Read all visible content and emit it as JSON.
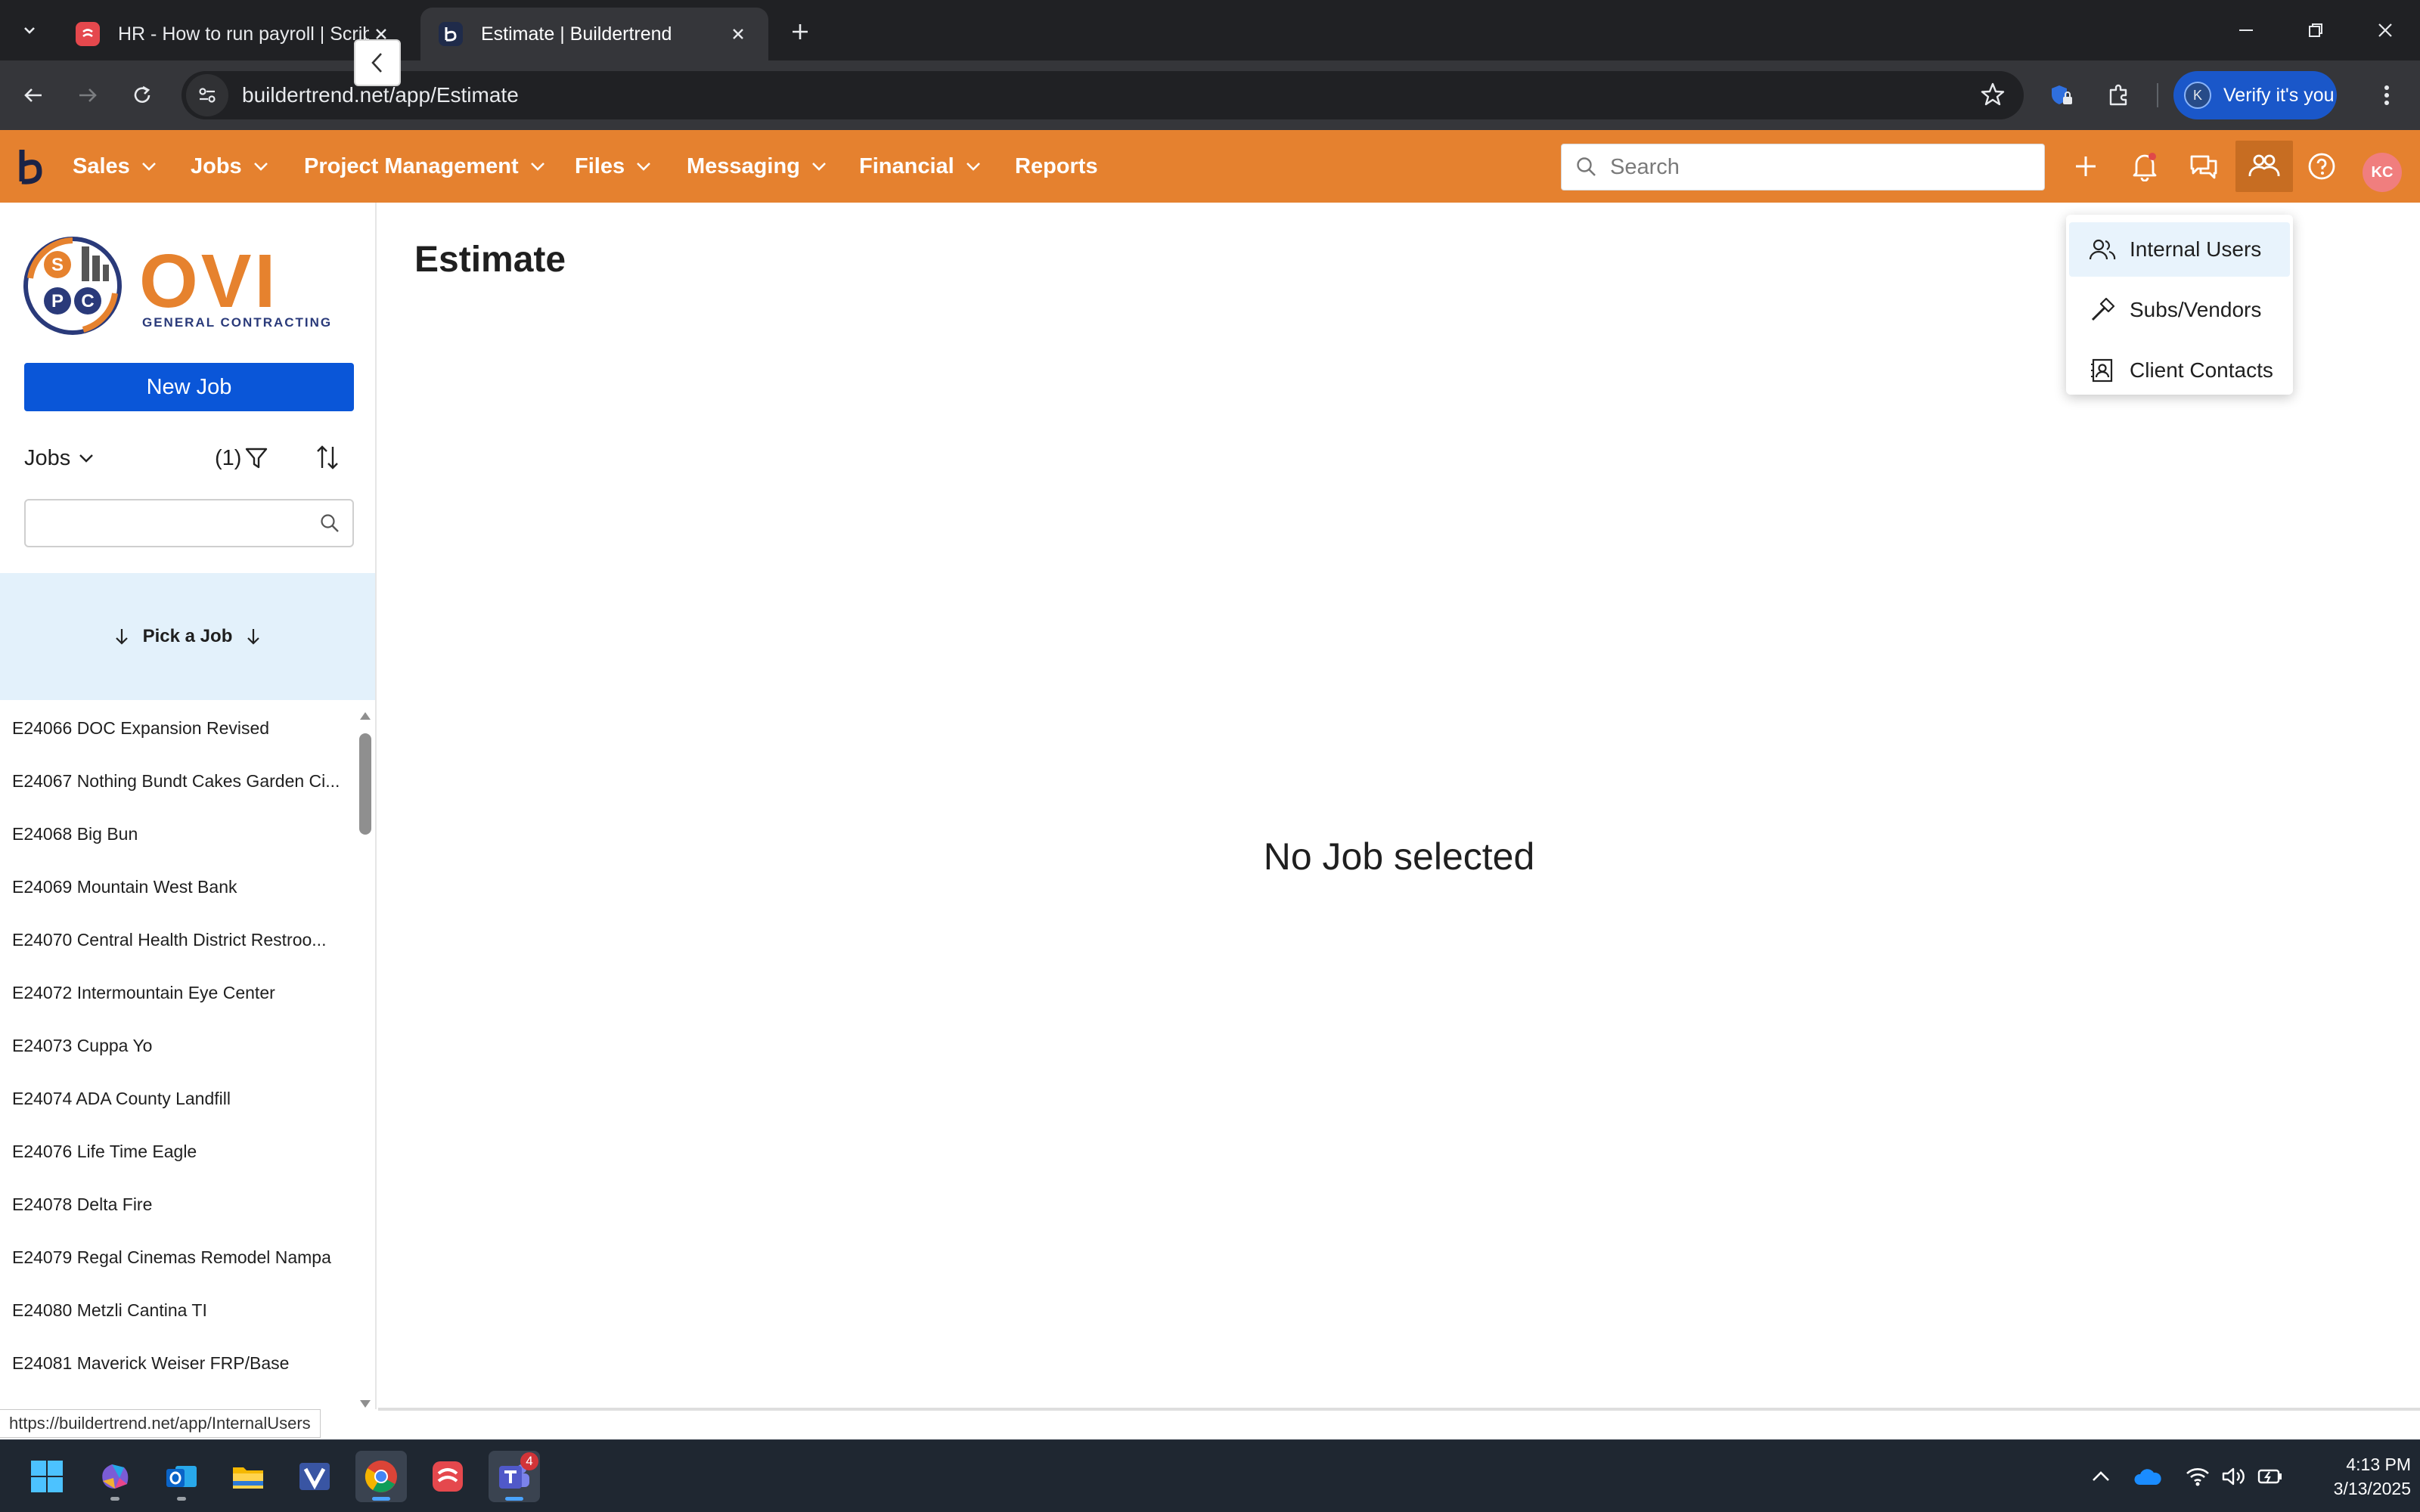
{
  "browser": {
    "tabs": [
      {
        "title": "HR - How to run payroll | Scribe",
        "active": false,
        "favicon": "scribe-icon"
      },
      {
        "title": "Estimate | Buildertrend",
        "active": true,
        "favicon": "buildertrend-icon"
      }
    ],
    "url": "buildertrend.net/app/Estimate",
    "profile_initial": "K",
    "verify_label": "Verify it's you"
  },
  "appnav": {
    "items": [
      {
        "label": "Sales",
        "has_menu": true
      },
      {
        "label": "Jobs",
        "has_menu": true
      },
      {
        "label": "Project Management",
        "has_menu": true
      },
      {
        "label": "Files",
        "has_menu": true
      },
      {
        "label": "Messaging",
        "has_menu": true
      },
      {
        "label": "Financial",
        "has_menu": true
      },
      {
        "label": "Reports",
        "has_menu": false
      }
    ],
    "search_placeholder": "Search",
    "avatar_initials": "KC",
    "accent_color": "#e5812f"
  },
  "contacts_menu": {
    "items": [
      {
        "label": "Internal Users",
        "icon": "users-icon"
      },
      {
        "label": "Subs/Vendors",
        "icon": "hammer-icon"
      },
      {
        "label": "Client Contacts",
        "icon": "contact-card-icon"
      }
    ]
  },
  "sidebar": {
    "logo": {
      "initials": [
        "S",
        "P",
        "C"
      ],
      "wordmark": "OVI",
      "tagline": "GENERAL CONTRACTING"
    },
    "new_job_label": "New Job",
    "jobs_dropdown_label": "Jobs",
    "filter_count": "(1)",
    "search_value": "",
    "pick_job_label": "Pick a Job",
    "jobs": [
      "E24066 DOC Expansion Revised",
      "E24067 Nothing Bundt Cakes Garden Ci...",
      "E24068 Big Bun",
      "E24069 Mountain West Bank",
      "E24070 Central Health District Restroo...",
      "E24072 Intermountain Eye Center",
      "E24073 Cuppa Yo",
      "E24074 ADA County Landfill",
      "E24076 Life Time Eagle",
      "E24078 Delta Fire",
      "E24079 Regal Cinemas Remodel Nampa",
      "E24080 Metzli Cantina TI",
      "E24081 Maverick Weiser FRP/Base"
    ]
  },
  "main": {
    "title": "Estimate",
    "empty_state": "No Job selected"
  },
  "status_link": "https://buildertrend.net/app/InternalUsers",
  "taskbar": {
    "time": "4:13 PM",
    "date": "3/13/2025",
    "teams_badge": "4",
    "apps": [
      "windows-start-icon",
      "microsoft-365-icon",
      "outlook-icon",
      "file-explorer-icon",
      "visio-icon",
      "chrome-icon",
      "scribe-icon",
      "teams-icon"
    ]
  }
}
